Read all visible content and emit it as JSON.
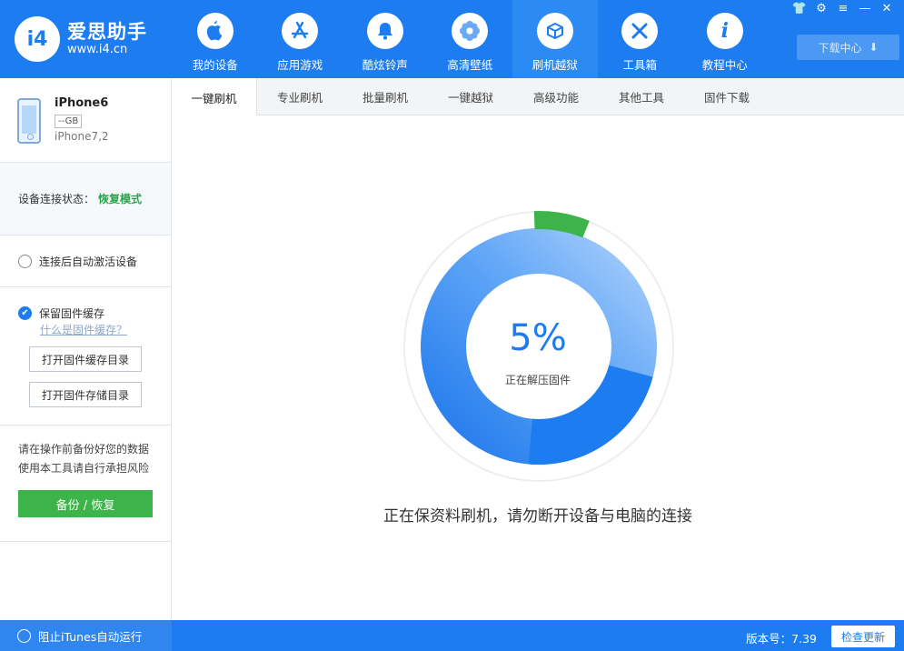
{
  "app": {
    "logo_badge": "i4",
    "logo_title": "爱思助手",
    "logo_url": "www.i4.cn"
  },
  "nav": [
    {
      "label": "我的设备",
      "icon": "apple-icon",
      "glyph": ""
    },
    {
      "label": "应用游戏",
      "icon": "app-store-icon",
      "glyph": "A"
    },
    {
      "label": "酷炫铃声",
      "icon": "bell-icon",
      "glyph": "🔔"
    },
    {
      "label": "高清壁纸",
      "icon": "flower-icon",
      "glyph": "❀"
    },
    {
      "label": "刷机越狱",
      "icon": "box-icon",
      "glyph": "⬡"
    },
    {
      "label": "工具箱",
      "icon": "tools-icon",
      "glyph": "✕"
    },
    {
      "label": "教程中心",
      "icon": "info-icon",
      "glyph": "i"
    }
  ],
  "window_controls": {
    "shirt": "👕",
    "settings": "⚙",
    "menu": "≡",
    "minimize": "—",
    "close": "✕"
  },
  "download": {
    "label": "下载中心",
    "icon": "⬇"
  },
  "device": {
    "name": "iPhone6",
    "capacity": "--GB",
    "model": "iPhone7,2"
  },
  "status": {
    "label": "设备连接状态：",
    "value": "恢复模式"
  },
  "sidebar": {
    "auto_activate": "连接后自动激活设备",
    "keep_cache": "保留固件缓存",
    "what_is_cache": "什么是固件缓存？",
    "open_cache_dir": "打开固件缓存目录",
    "open_store_dir": "打开固件存储目录",
    "warn_line1": "请在操作前备份好您的数据",
    "warn_line2": "使用本工具请自行承担风险",
    "backup": "备份 / 恢复"
  },
  "tabs": [
    "一键刷机",
    "专业刷机",
    "批量刷机",
    "一键越狱",
    "高级功能",
    "其他工具",
    "固件下载"
  ],
  "progress": {
    "percent": 5,
    "percent_text": "5%",
    "stage": "正在解压固件",
    "message": "正在保资料刷机，请勿断开设备与电脑的连接",
    "outer_color": "#3cb44a",
    "ring_color": "#1c7cf0"
  },
  "footer": {
    "block_itunes": "阻止iTunes自动运行",
    "version": "版本号：7.39",
    "check_update": "检查更新"
  }
}
